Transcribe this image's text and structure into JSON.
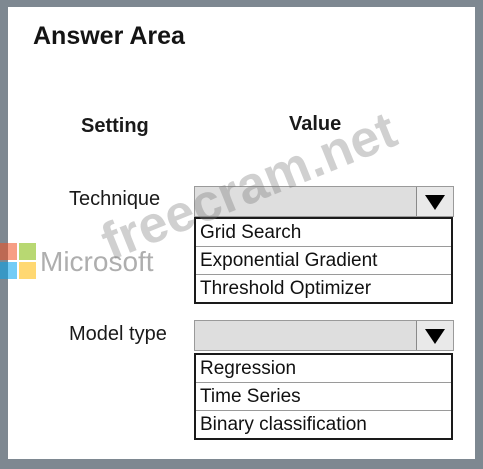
{
  "title": "Answer Area",
  "headers": {
    "setting": "Setting",
    "value": "Value"
  },
  "rows": [
    {
      "label": "Technique",
      "selected": "",
      "options": [
        "Grid Search",
        "Exponential Gradient",
        "Threshold Optimizer"
      ]
    },
    {
      "label": "Model type",
      "selected": "",
      "options": [
        "Regression",
        "Time Series",
        "Binary classification"
      ]
    }
  ],
  "watermark": {
    "brand": "Microsoft",
    "site": "freecram.net"
  },
  "icons": {
    "dropdown": "triangle-down-icon",
    "logo": "microsoft-logo-icon"
  },
  "colors": {
    "frame": "#7e8891",
    "panel": "#ffffff",
    "dropdown_fill": "#dedede",
    "logo_red": "#f25022",
    "logo_green": "#7fba00",
    "logo_blue": "#00a4ef",
    "logo_yellow": "#ffb900"
  }
}
